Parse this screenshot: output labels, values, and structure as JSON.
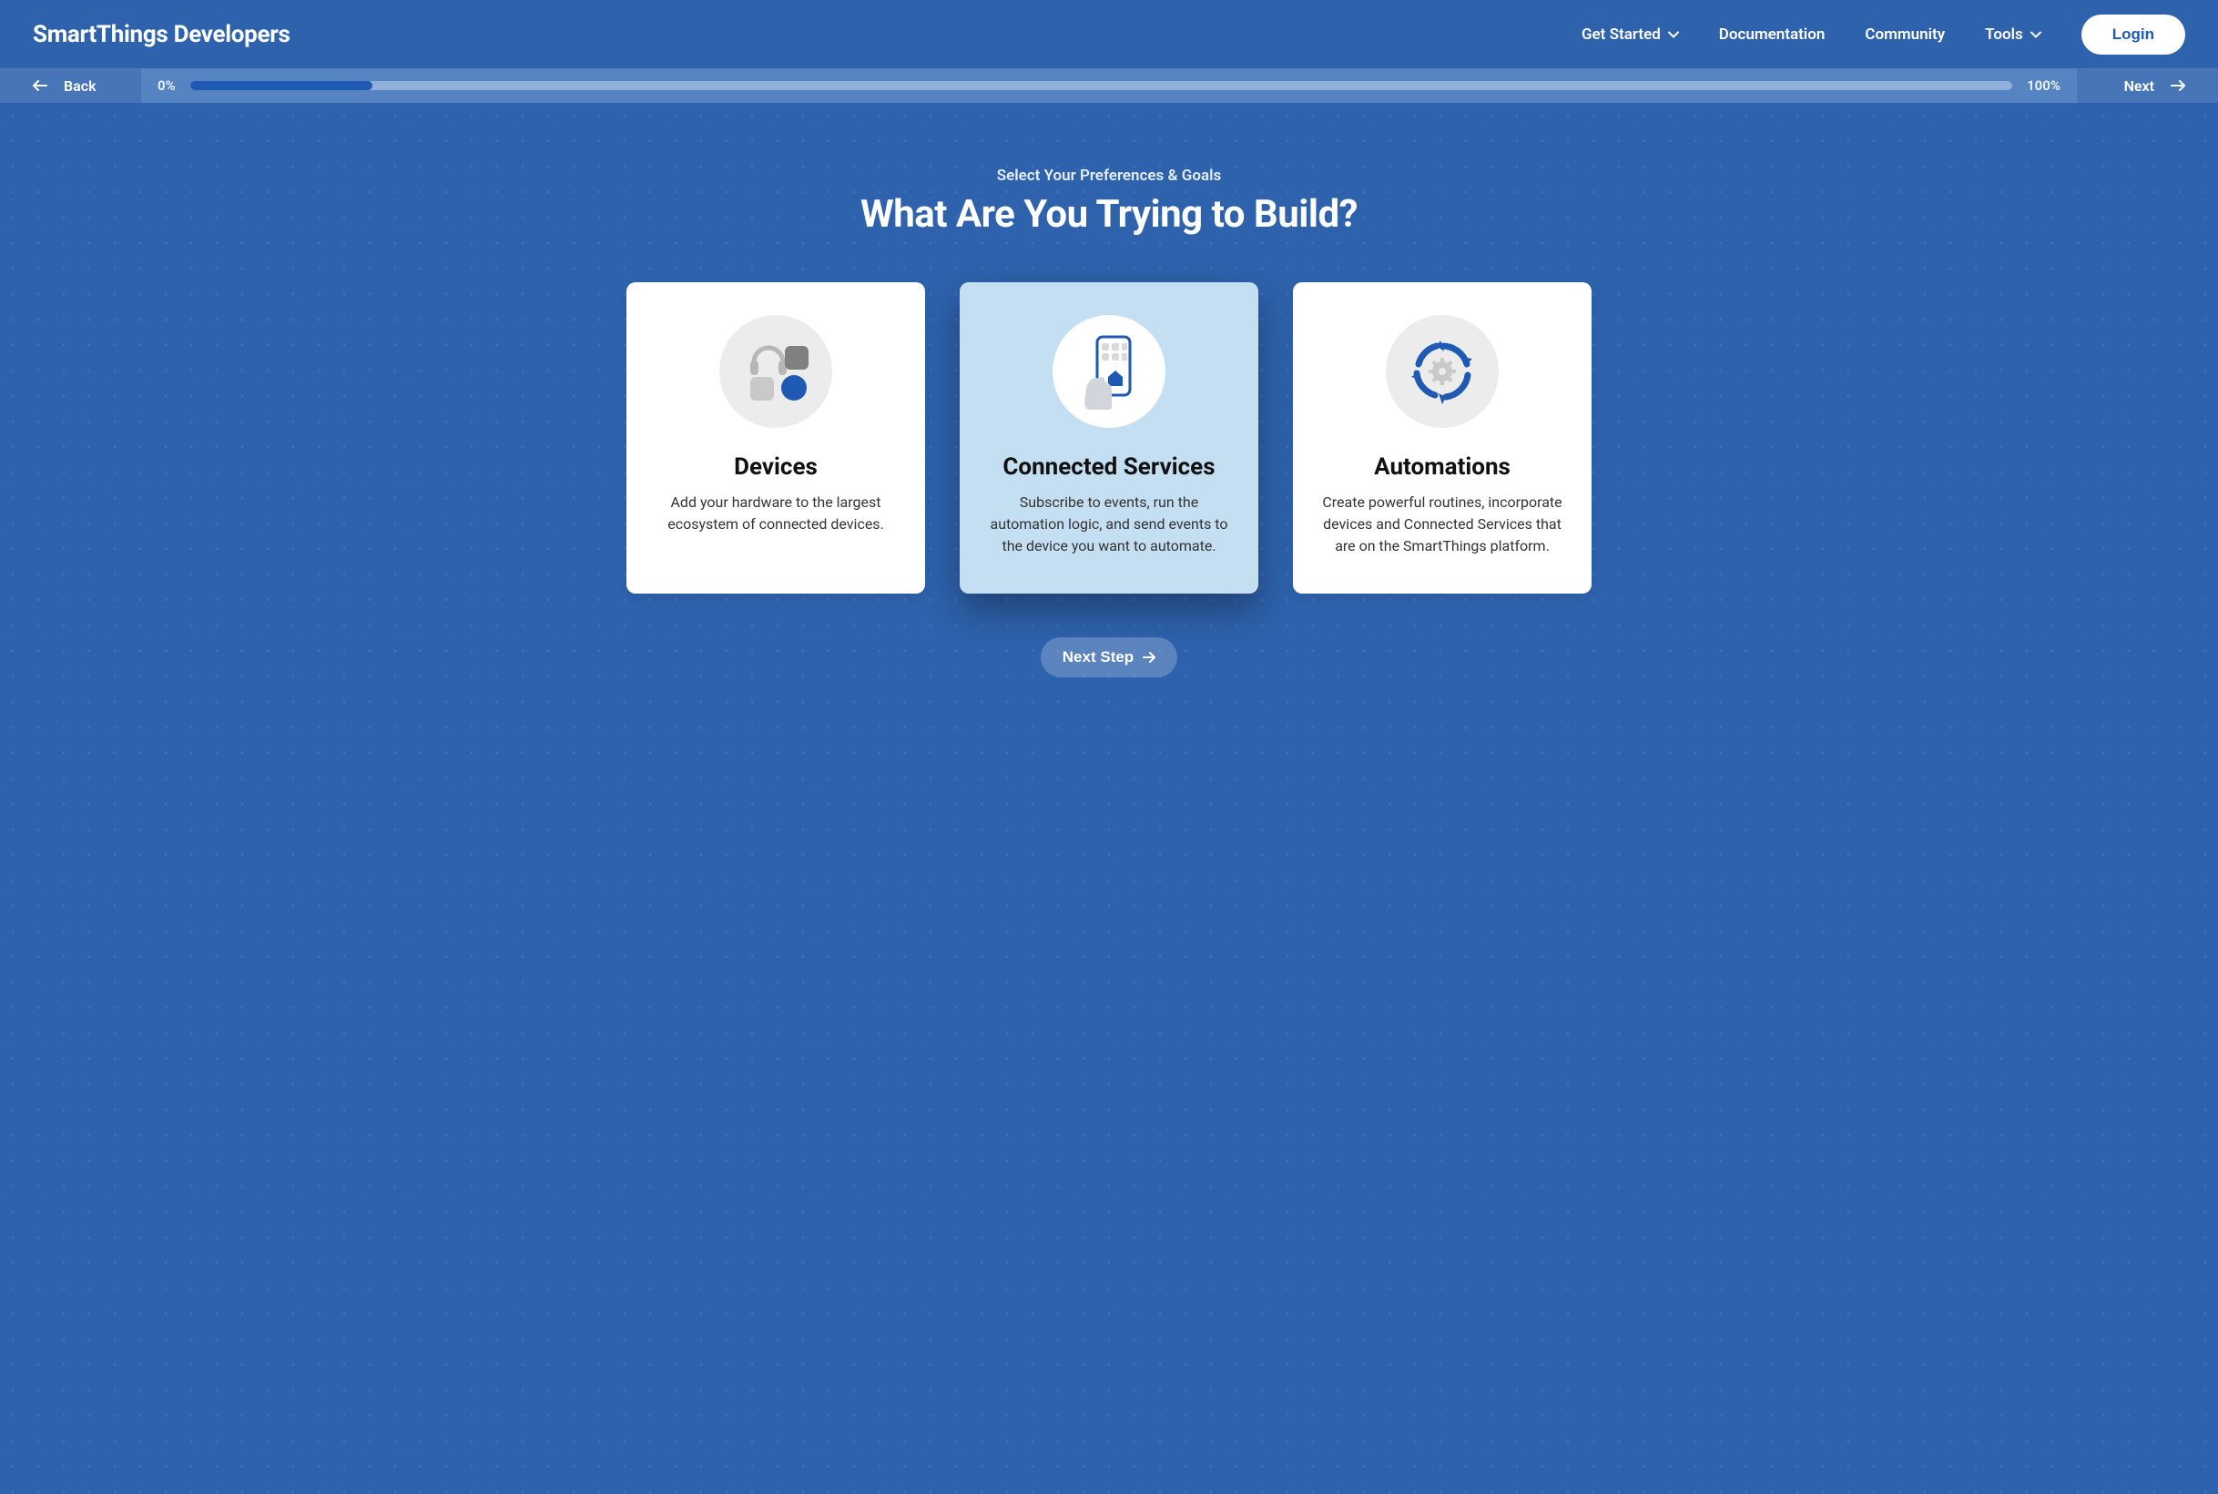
{
  "header": {
    "logo": "SmartThings Developers",
    "nav": {
      "get_started": "Get Started",
      "documentation": "Documentation",
      "community": "Community",
      "tools": "Tools"
    },
    "login": "Login"
  },
  "progress": {
    "back": "Back",
    "next": "Next",
    "pct_start": "0%",
    "pct_end": "100%",
    "fill_percent": 10
  },
  "main": {
    "eyebrow": "Select Your Preferences & Goals",
    "title": "What Are You Trying to Build?",
    "next_step": "Next Step"
  },
  "cards": [
    {
      "id": "devices",
      "title": "Devices",
      "desc": "Add your hardware to the largest ecosystem of connected devices.",
      "selected": false
    },
    {
      "id": "connected-services",
      "title": "Connected Services",
      "desc": "Subscribe to events, run the automation logic, and send events to the device you want to automate.",
      "selected": true
    },
    {
      "id": "automations",
      "title": "Automations",
      "desc": "Create powerful routines, incorporate devices and Connected Services that are on the SmartThings platform.",
      "selected": false
    }
  ]
}
